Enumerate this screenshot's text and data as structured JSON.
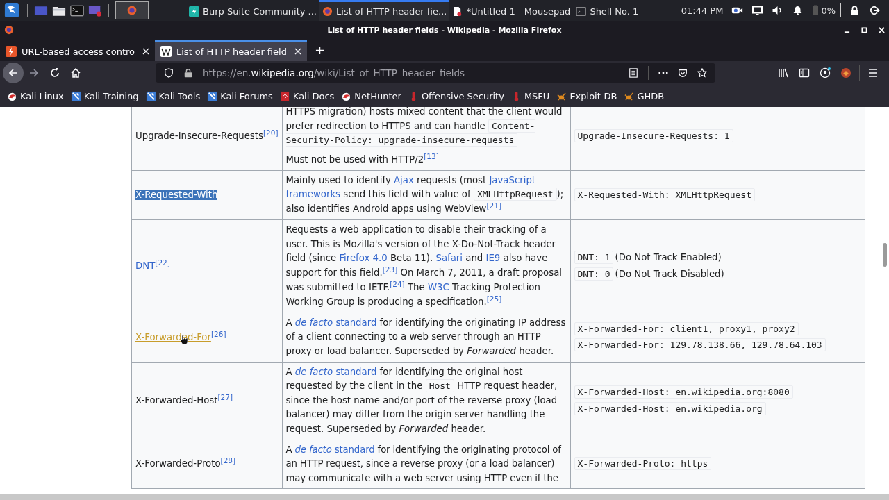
{
  "taskbar": {
    "windows": [
      {
        "title": "Burp Suite Community ...",
        "kind": "burp",
        "selected": false
      },
      {
        "title": "List of HTTP header fie...",
        "kind": "browser",
        "selected": true
      },
      {
        "title": "*Untitled 1 - Mousepad",
        "kind": "editor",
        "selected": false
      },
      {
        "title": "Shell No. 1",
        "kind": "terminal",
        "selected": false
      }
    ],
    "clock": "01:44 PM",
    "battery": "0%"
  },
  "window": {
    "title": "List of HTTP header fields - Wikipedia - Mozilla Firefox"
  },
  "tabs": [
    {
      "label": "URL-based access contro",
      "kind": "burp",
      "selected": false
    },
    {
      "label": "List of HTTP header field",
      "kind": "wiki",
      "selected": true
    }
  ],
  "address_bar": {
    "scheme": "https://en.",
    "domain": "wikipedia.org",
    "path": "/wiki/List_of_HTTP_header_fields"
  },
  "bookmarks": [
    {
      "label": "Kali Linux",
      "kind": "dragon"
    },
    {
      "label": "Kali Training",
      "kind": "tool"
    },
    {
      "label": "Kali Tools",
      "kind": "tool"
    },
    {
      "label": "Kali Forums",
      "kind": "tool"
    },
    {
      "label": "Kali Docs",
      "kind": "docs"
    },
    {
      "label": "NetHunter",
      "kind": "dragon"
    },
    {
      "label": "Offensive Security",
      "kind": "thermo"
    },
    {
      "label": "MSFU",
      "kind": "thermo"
    },
    {
      "label": "Exploit-DB",
      "kind": "bug"
    },
    {
      "label": "GHDB",
      "kind": "bug"
    }
  ],
  "table": {
    "rows": [
      {
        "name": {
          "text": "Upgrade-Insecure-Requests",
          "kind": "plain",
          "ref": "[20]"
        },
        "description": [
          [
            {
              "kind": "text",
              "text": "HTTPS migration) hosts mixed content that the client would prefer redirection to HTTPS and can handle "
            },
            {
              "kind": "code",
              "text": "Content-Security-Policy: upgrade-insecure-requests"
            }
          ],
          [
            {
              "kind": "text",
              "text": "Must not be used with HTTP/2"
            },
            {
              "kind": "ref",
              "text": "[13]"
            }
          ]
        ],
        "examples": [
          {
            "code": "Upgrade-Insecure-Requests: 1"
          }
        ]
      },
      {
        "name": {
          "text": "X-Requested-With",
          "kind": "selected"
        },
        "description": [
          [
            {
              "kind": "text",
              "text": "Mainly used to identify "
            },
            {
              "kind": "link",
              "text": "Ajax"
            },
            {
              "kind": "text",
              "text": " requests (most "
            },
            {
              "kind": "link",
              "text": "JavaScript"
            },
            {
              "kind": "link",
              "text": "frameworks"
            },
            {
              "kind": "text",
              "text": " send this field with value of "
            },
            {
              "kind": "code",
              "text": "XMLHttpRequest"
            },
            {
              "kind": "text",
              "text": "); also identifies Android apps using WebView"
            },
            {
              "kind": "ref",
              "text": "[21]"
            }
          ]
        ],
        "examples": [
          {
            "code": "X-Requested-With: XMLHttpRequest"
          }
        ]
      },
      {
        "name": {
          "text": "DNT",
          "kind": "link",
          "ref": "[22]"
        },
        "description": [
          [
            {
              "kind": "text",
              "text": "Requests a web application to disable their tracking of a user. This is Mozilla's version of the X-Do-Not-Track header field (since "
            },
            {
              "kind": "link",
              "text": "Firefox 4.0"
            },
            {
              "kind": "text",
              "text": " Beta 11). "
            },
            {
              "kind": "link",
              "text": "Safari"
            },
            {
              "kind": "text",
              "text": " and "
            },
            {
              "kind": "link",
              "text": "IE9"
            },
            {
              "kind": "text",
              "text": " also have support for this field."
            },
            {
              "kind": "ref",
              "text": "[23]"
            },
            {
              "kind": "text",
              "text": " On March 7, 2011, a draft proposal was submitted to IETF."
            },
            {
              "kind": "ref",
              "text": "[24]"
            },
            {
              "kind": "text",
              "text": " The "
            },
            {
              "kind": "link",
              "text": "W3C"
            },
            {
              "kind": "text",
              "text": " Tracking Protection Working Group is producing a specification."
            },
            {
              "kind": "ref",
              "text": "[25]"
            }
          ]
        ],
        "examples": [
          {
            "code": "DNT: 1",
            "note": "(Do Not Track Enabled)"
          },
          {
            "code": "DNT: 0",
            "note": "(Do Not Track Disabled)"
          }
        ]
      },
      {
        "name": {
          "text": "X-Forwarded-For",
          "kind": "hovered",
          "ref": "[26]"
        },
        "description": [
          [
            {
              "kind": "text",
              "text": "A "
            },
            {
              "kind": "link",
              "text": "*de facto* standard"
            },
            {
              "kind": "text",
              "text": " for identifying the originating IP address of a client connecting to a web server through an HTTP proxy or load balancer. Superseded by *Forwarded* header."
            }
          ]
        ],
        "examples": [
          {
            "code": "X-Forwarded-For: client1, proxy1, proxy2"
          },
          {
            "code": "X-Forwarded-For: 129.78.138.66, 129.78.64.103"
          }
        ]
      },
      {
        "name": {
          "text": "X-Forwarded-Host",
          "kind": "plain",
          "ref": "[27]"
        },
        "description": [
          [
            {
              "kind": "text",
              "text": "A "
            },
            {
              "kind": "link",
              "text": "*de facto* standard"
            },
            {
              "kind": "text",
              "text": " for identifying the original host requested by the client in the "
            },
            {
              "kind": "code",
              "text": "Host"
            },
            {
              "kind": "text",
              "text": " HTTP request header, since the host name and/or port of the reverse proxy (load balancer) may differ from the origin server handling the request. Superseded by *Forwarded* header."
            }
          ]
        ],
        "examples": [
          {
            "code": "X-Forwarded-Host: en.wikipedia.org:8080"
          },
          {
            "code": "X-Forwarded-Host: en.wikipedia.org"
          }
        ]
      },
      {
        "name": {
          "text": "X-Forwarded-Proto",
          "kind": "plain",
          "ref": "[28]"
        },
        "description": [
          [
            {
              "kind": "text",
              "text": "A "
            },
            {
              "kind": "link",
              "text": "*de facto* standard"
            },
            {
              "kind": "text",
              "text": " for identifying the originating protocol of an HTTP request, since a reverse proxy (or a load balancer) may communicate with a web server using HTTP even if the"
            }
          ]
        ],
        "examples": [
          {
            "code": "X-Forwarded-Proto: https"
          }
        ]
      }
    ]
  }
}
